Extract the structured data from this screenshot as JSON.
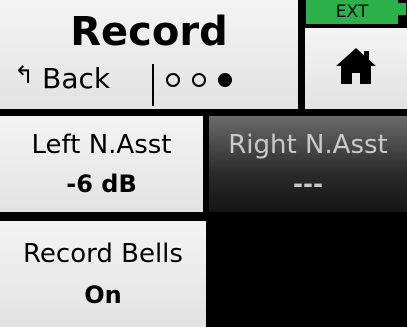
{
  "header": {
    "title": "Record",
    "back_label": "Back",
    "back_icon": "return-arrow-icon",
    "page_dots": [
      "empty",
      "empty",
      "filled"
    ]
  },
  "status": {
    "ext_label": "EXT",
    "ext_color": "#2bb14a"
  },
  "home": {
    "icon": "home-icon"
  },
  "settings": {
    "left_asst": {
      "label": "Left N.Asst",
      "value": "-6 dB"
    },
    "right_asst": {
      "label": "Right N.Asst",
      "value": "---"
    },
    "record_bells": {
      "label": "Record Bells",
      "value": "On"
    }
  }
}
